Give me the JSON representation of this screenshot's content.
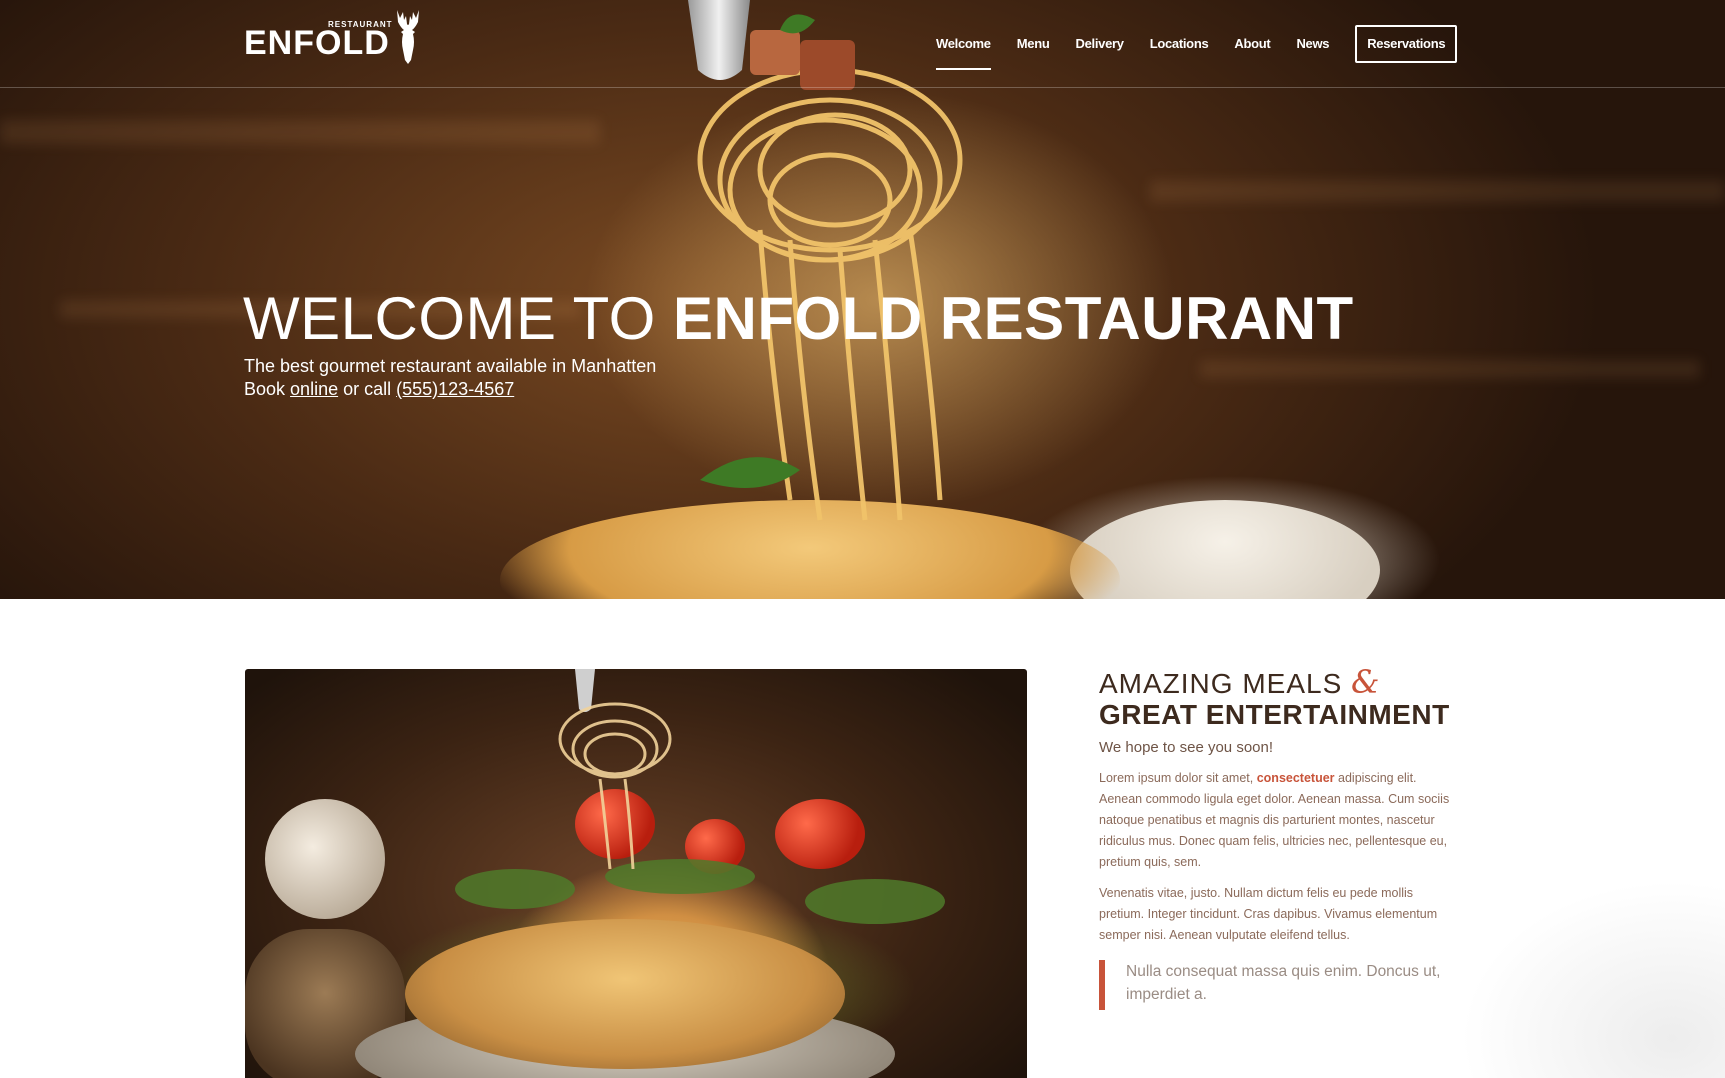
{
  "header": {
    "logo": {
      "small": "RESTAURANT",
      "main": "ENFOLD"
    },
    "nav": [
      {
        "label": "Welcome",
        "active": true
      },
      {
        "label": "Menu"
      },
      {
        "label": "Delivery"
      },
      {
        "label": "Locations"
      },
      {
        "label": "About"
      },
      {
        "label": "News"
      }
    ],
    "reservations_label": "Reservations"
  },
  "hero": {
    "title_light": "WELCOME TO",
    "title_bold": "ENFOLD RESTAURANT",
    "subtitle": "The best gourmet restaurant available in Manhatten",
    "book_prefix": "Book",
    "book_link": "online",
    "book_mid": "or call",
    "phone": "(555)123-4567"
  },
  "content": {
    "title_light": "AMAZING MEALS",
    "amp": "&",
    "title_bold": "GREAT ENTERTAINMENT",
    "subtitle": "We hope to see you soon!",
    "p1_start": "Lorem ipsum dolor sit amet,",
    "p1_highlight": "consectetuer",
    "p1_rest": "adipiscing elit. Aenean commodo ligula eget dolor. Aenean massa. Cum sociis natoque penatibus et magnis dis parturient montes, nascetur ridiculus mus. Donec quam felis, ultricies nec, pellentesque eu, pretium quis, sem.",
    "p2": "Venenatis vitae, justo. Nullam dictum felis eu pede mollis pretium. Integer tincidunt. Cras dapibus. Vivamus elementum semper nisi. Aenean vulputate eleifend tellus.",
    "quote": "Nulla consequat massa quis enim. Doncus ut, imperdiet a."
  },
  "colors": {
    "accent": "#c8543a",
    "heading": "#3d2a1e",
    "body": "#8b6a5a"
  },
  "icons": [
    "deer-logo-icon"
  ]
}
